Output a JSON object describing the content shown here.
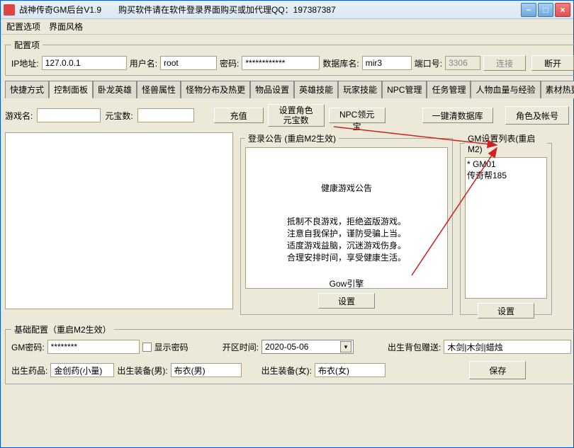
{
  "title": "战神传奇GM后台V1.9　　购买软件请在软件登录界面购买或加代理QQ：197387387",
  "menubar": [
    "配置选项",
    "界面风格"
  ],
  "config": {
    "legend": "配置项",
    "ip_label": "IP地址:",
    "ip": "127.0.0.1",
    "user_label": "用户名:",
    "user": "root",
    "pwd_label": "密码:",
    "pwd": "************",
    "db_label": "数据库名:",
    "db": "mir3",
    "port_label": "端口号:",
    "port": "3306",
    "connect": "连接",
    "disconnect": "断开"
  },
  "tabs": [
    "快捷方式",
    "控制面板",
    "卧龙英雄",
    "怪兽属性",
    "怪物分布及热更",
    "物品设置",
    "英雄技能",
    "玩家技能",
    "NPC管理",
    "任务管理",
    "人物血量与经验",
    "素材热更"
  ],
  "active_tab": 1,
  "panel": {
    "game_label": "游戏名:",
    "yb_label": "元宝数:",
    "recharge": "充值",
    "set_char_yb": "设置角色元宝数",
    "npc_yb": "NPC领元宝",
    "clear_db": "一键清数据库",
    "char_acct": "角色及帐号"
  },
  "login_notice": {
    "legend": "登录公告 (重启M2生效)",
    "title": "健康游戏公告",
    "lines": [
      "抵制不良游戏，拒绝盗版游戏。",
      "注意自我保护，谨防受骗上当。",
      "适度游戏益脑，沉迷游戏伤身。",
      "合理安排时间，享受健康生活。"
    ],
    "footer": "Gow引擎",
    "set_btn": "设置"
  },
  "gm_list": {
    "legend": "GM设置列表(重启M2)",
    "items": [
      "* GM01",
      "传奇帮185"
    ],
    "set_btn": "设置"
  },
  "basic": {
    "legend": "基础配置（重启M2生效）",
    "gmpwd_label": "GM密码:",
    "gmpwd": "********",
    "showpwd": "显示密码",
    "open_label": "开区时间:",
    "open": "2020-05-06",
    "gift_label": "出生背包赠送:",
    "gift": "木剑|木剑|蜡烛",
    "med_label": "出生药品:",
    "med": "金创药(小量)",
    "equipm_label": "出生装备(男):",
    "equipm": "布衣(男)",
    "equipf_label": "出生装备(女):",
    "equipf": "布衣(女)",
    "save": "保存"
  },
  "winbtns": {
    "min": "−",
    "max": "□",
    "close": "×"
  }
}
